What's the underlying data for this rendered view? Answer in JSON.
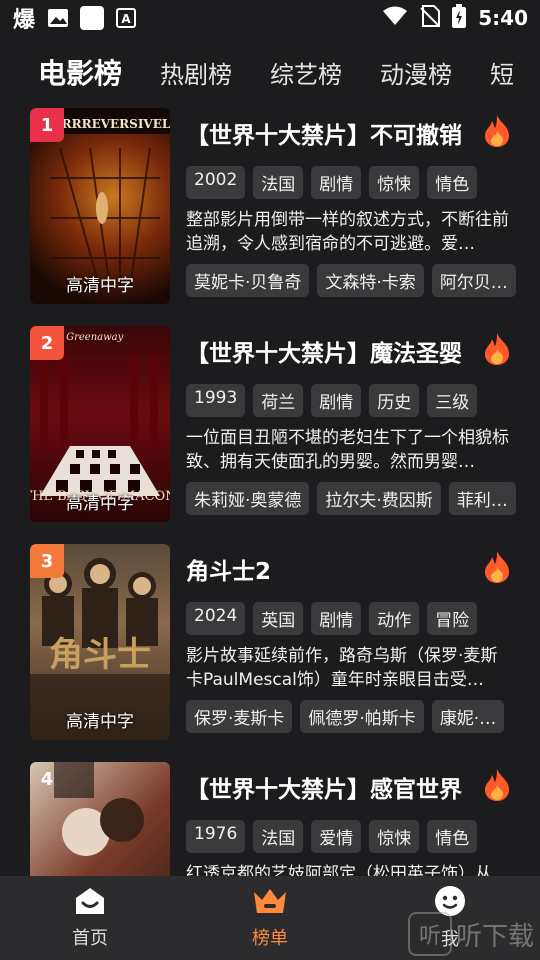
{
  "status": {
    "time": "5:40",
    "app_glyph": "爆"
  },
  "tabs": [
    "电影榜",
    "热剧榜",
    "综艺榜",
    "动漫榜",
    "短"
  ],
  "items": [
    {
      "rank": "1",
      "rank_color": "#e8304a",
      "poster_text": "RRREVERSIVEL",
      "hd": "高清中字",
      "title": "【世界十大禁片】不可撤销",
      "tags": [
        "2002",
        "法国",
        "剧情",
        "惊悚",
        "情色"
      ],
      "desc": "整部影片用倒带一样的叙述方式，不断往前追溯，令人感到宿命的不可逃避。爱…",
      "actors": [
        "莫妮卡·贝鲁奇",
        "文森特·卡索",
        "阿尔贝…"
      ]
    },
    {
      "rank": "2",
      "rank_color": "#f2533a",
      "poster_text": "Peter Greenaway",
      "poster_sub": "THE BABY OF MACON",
      "hd": "高清中字",
      "title": "【世界十大禁片】魔法圣婴",
      "tags": [
        "1993",
        "荷兰",
        "剧情",
        "历史",
        "三级"
      ],
      "desc": "一位面目丑陋不堪的老妇生下了一个相貌标致、拥有天使面孔的男婴。然而男婴…",
      "actors": [
        "朱莉娅·奥蒙德",
        "拉尔夫·费因斯",
        "菲利…"
      ]
    },
    {
      "rank": "3",
      "rank_color": "#f47a3c",
      "poster_text": "角斗士",
      "hd": "高清中字",
      "title": "角斗士2",
      "tags": [
        "2024",
        "英国",
        "剧情",
        "动作",
        "冒险"
      ],
      "desc": "影片故事延续前作，路奇乌斯（保罗·麦斯卡PaulMescal饰）童年时亲眼目击受…",
      "actors": [
        "保罗·麦斯卡",
        "佩德罗·帕斯卡",
        "康妮·…"
      ]
    },
    {
      "rank": "4",
      "rank_color": "transparent",
      "poster_text": "",
      "hd": "",
      "title": "【世界十大禁片】感官世界",
      "tags": [
        "1976",
        "法国",
        "爱情",
        "惊悚",
        "情色"
      ],
      "desc": "红透京都的艺妓阿部定（松田英子饰）从…",
      "actors": []
    }
  ],
  "nav": [
    {
      "label": "首页",
      "icon": "home-smile-icon"
    },
    {
      "label": "榜单",
      "icon": "crown-icon"
    },
    {
      "label": "我",
      "icon": "smile-face-icon"
    }
  ],
  "watermark": {
    "glyph": "听",
    "text": "听下载"
  },
  "colors": {
    "accent": "#ff8a3d",
    "background": "#1c1c1e",
    "tag_bg": "#3a3a3c"
  }
}
